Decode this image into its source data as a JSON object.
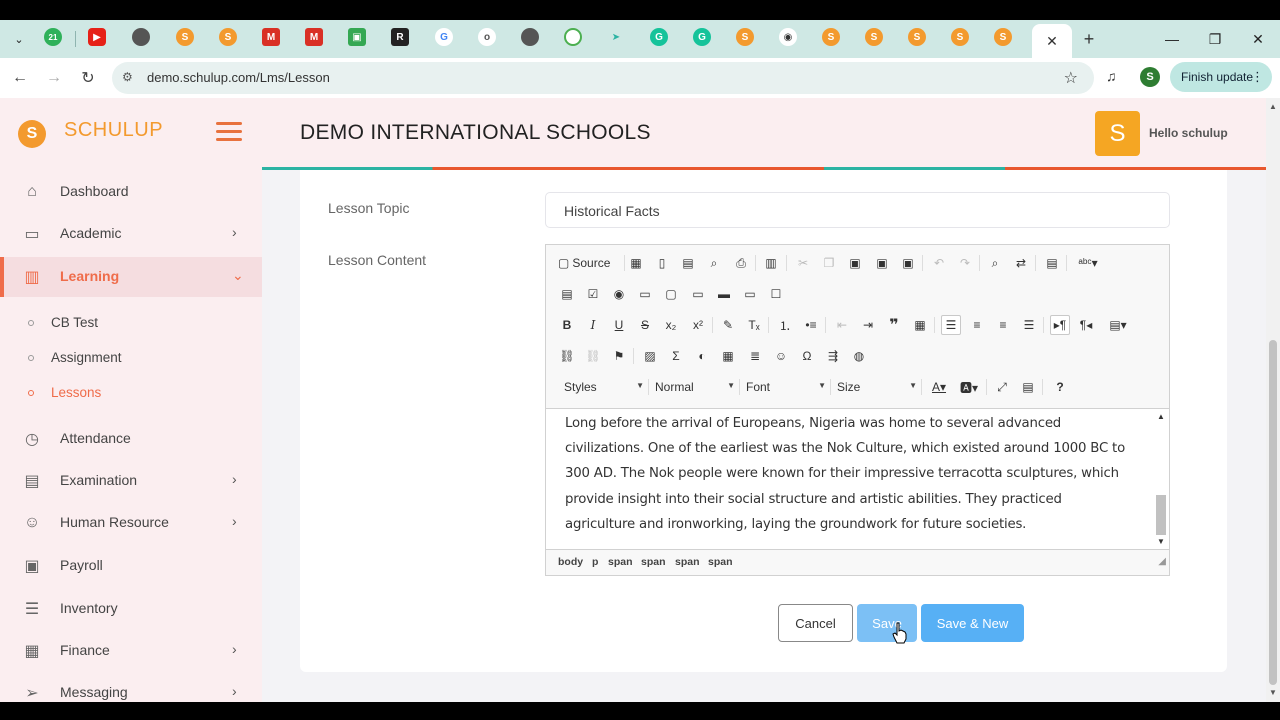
{
  "browser": {
    "url": "demo.schulup.com/Lms/Lesson",
    "profile_initial": "S",
    "finish_update_label": "Finish update",
    "new_tab": "+",
    "tab_badge": "21",
    "active_tab_close": "✕"
  },
  "brand": {
    "logo_letter": "S",
    "name": "SCHULUP"
  },
  "header": {
    "school_name": "DEMO INTERNATIONAL SCHOOLS",
    "avatar_letter": "S",
    "greeting": "Hello schulup"
  },
  "sidebar": {
    "items": [
      {
        "label": "Dashboard",
        "icon": "home-icon"
      },
      {
        "label": "Academic",
        "icon": "folder-icon",
        "chevron": "›"
      },
      {
        "label": "Learning",
        "icon": "book-icon",
        "chevron": "⌄"
      },
      {
        "label": "Attendance",
        "icon": "clock-icon"
      },
      {
        "label": "Examination",
        "icon": "clipboard-icon",
        "chevron": "›"
      },
      {
        "label": "Human Resource",
        "icon": "user-icon",
        "chevron": "›"
      },
      {
        "label": "Payroll",
        "icon": "money-icon"
      },
      {
        "label": "Inventory",
        "icon": "list-icon"
      },
      {
        "label": "Finance",
        "icon": "briefcase-icon",
        "chevron": "›"
      },
      {
        "label": "Messaging",
        "icon": "send-icon",
        "chevron": "›"
      }
    ],
    "sub_items": [
      {
        "label": "CB Test"
      },
      {
        "label": "Assignment"
      },
      {
        "label": "Lessons"
      }
    ]
  },
  "form": {
    "topic_label": "Lesson Topic",
    "topic_value": "Historical Facts",
    "content_label": "Lesson Content"
  },
  "editor": {
    "source_label": "Source",
    "styles_label": "Styles",
    "format_label": "Normal",
    "font_label": "Font",
    "size_label": "Size",
    "content": "Long before the arrival of Europeans, Nigeria was home to several advanced civilizations. One of the earliest was the Nok Culture, which existed around 1000 BC to 300 AD. The Nok people were known for their impressive terracotta sculptures, which provide insight into their social structure and artistic abilities. They practiced agriculture and ironworking, laying the groundwork for future societies.",
    "path": [
      "body",
      "p",
      "span",
      "span",
      "span",
      "span"
    ]
  },
  "actions": {
    "cancel": "Cancel",
    "save": "Save",
    "save_new": "Save & New"
  }
}
